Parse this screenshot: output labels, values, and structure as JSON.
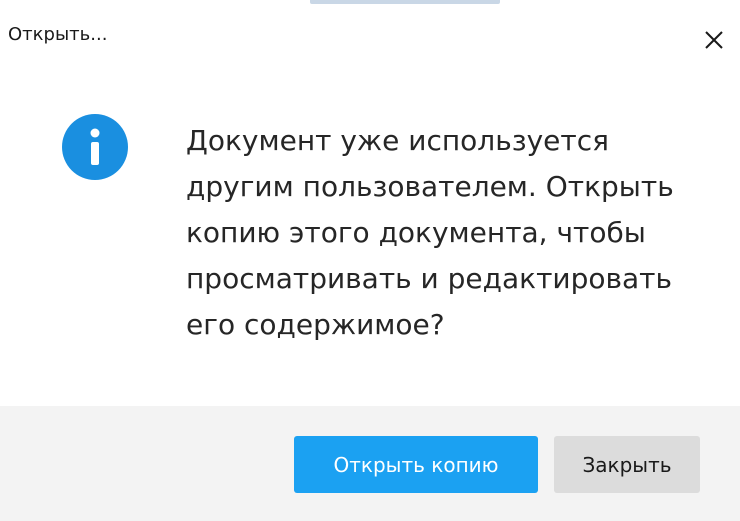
{
  "dialog": {
    "title": "Открыть...",
    "message": "Документ уже используется\nдругим пользователем. Открыть\nкопию этого документа, чтобы\nпросматривать и редактировать\nего содержимое?",
    "icon": "info-icon",
    "close_icon": "close-icon",
    "accent_color": "#1ba1f2"
  },
  "buttons": {
    "open_copy_label": "Открыть копию",
    "close_label": "Закрыть"
  }
}
